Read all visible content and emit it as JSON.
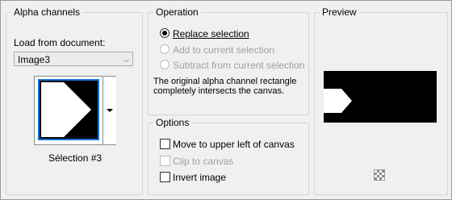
{
  "alpha_channels": {
    "title": "Alpha channels",
    "load_label": "Load from document:",
    "document_value": "Image3",
    "selection_caption": "Sélection #3"
  },
  "operation": {
    "title": "Operation",
    "options": [
      {
        "label": "Replace selection",
        "selected": true,
        "enabled": true
      },
      {
        "label": "Add to current selection",
        "selected": false,
        "enabled": false
      },
      {
        "label": "Subtract from current selection",
        "selected": false,
        "enabled": false
      }
    ],
    "description": "The original alpha channel rectangle completely intersects the canvas."
  },
  "options": {
    "title": "Options",
    "items": [
      {
        "label": "Move to upper left of canvas",
        "checked": false,
        "enabled": true
      },
      {
        "label": "Clip to canvas",
        "checked": false,
        "enabled": false
      },
      {
        "label": "Invert image",
        "checked": false,
        "enabled": true
      }
    ]
  },
  "preview": {
    "title": "Preview",
    "background_icon": "checkerboard-icon"
  },
  "colors": {
    "accent": "#1873d3",
    "mask_background": "#000000",
    "mask_shape": "#ffffff"
  }
}
